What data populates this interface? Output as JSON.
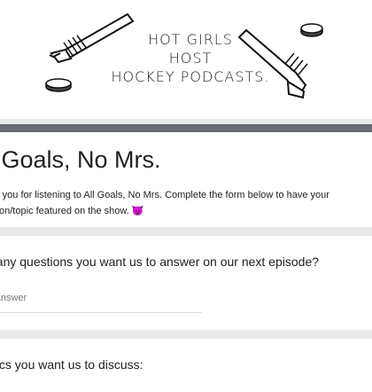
{
  "banner": {
    "lines": [
      "HOT GIRLS",
      "HOST",
      "HOCKEY PODCASTS."
    ]
  },
  "form": {
    "title": "l Goals, No Mrs.",
    "description": "nk you for listening to All Goals, No Mrs. Complete the form below to have your stion/topic featured on the show. 😈"
  },
  "questions": [
    {
      "label": "t any questions you want us to answer on our next episode?",
      "placeholder": "r answer"
    },
    {
      "label": "pics you want us to discuss:"
    }
  ],
  "colors": {
    "page_bg": "#e9e9ea",
    "accent_bar": "#6a6d72",
    "text": "#202124",
    "placeholder": "#757575"
  },
  "icons": [
    "hockey-stick-icon",
    "hockey-puck-icon"
  ]
}
